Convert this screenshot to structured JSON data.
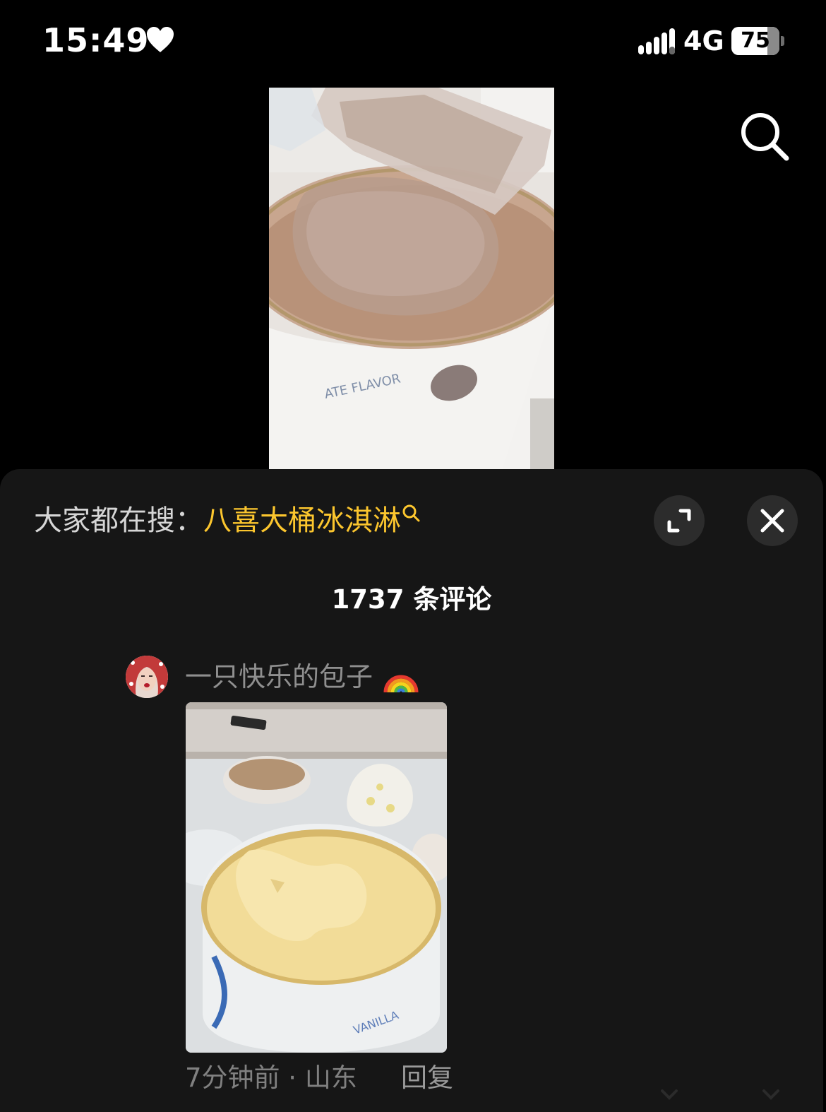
{
  "status_bar": {
    "time": "15:49",
    "network": "4G",
    "battery": "75",
    "battery_level": 0.75,
    "icons": [
      "heart-icon",
      "signal-icon",
      "battery-icon"
    ]
  },
  "video": {
    "icons": [
      "search-icon"
    ]
  },
  "comments_panel": {
    "hot_search_label": "大家都在搜：",
    "hot_search_term": "八喜大桶冰淇淋",
    "comment_count": "1737 条评论",
    "icons": [
      "expand-icon",
      "close-icon"
    ],
    "comments": [
      {
        "username": "一只快乐的包子",
        "emoji": "rainbow-icon",
        "meta": "7分钟前 · 山东",
        "reply": "回复"
      }
    ]
  },
  "colors": {
    "accent": "#fcc62e",
    "sheet_background": "#161616",
    "page_background": "#000000"
  }
}
